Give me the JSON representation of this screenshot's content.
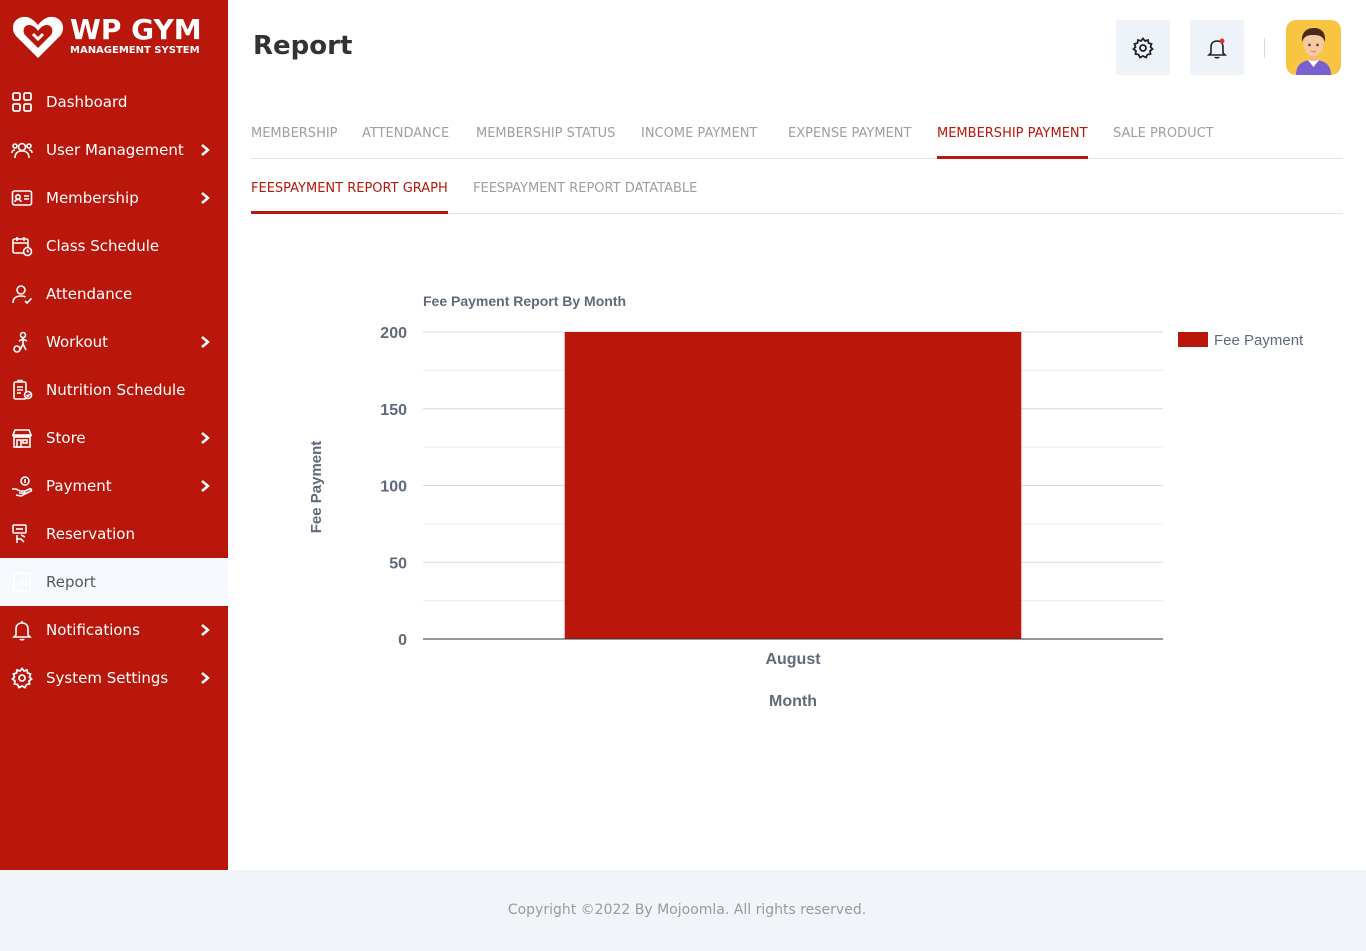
{
  "brand": {
    "title": "WP GYM",
    "subtitle": "MANAGEMENT SYSTEM"
  },
  "sidebar": {
    "items": [
      {
        "label": "Dashboard",
        "icon": "dashboard-icon",
        "has_submenu": false,
        "active": false
      },
      {
        "label": "User Management",
        "icon": "users-icon",
        "has_submenu": true,
        "active": false
      },
      {
        "label": "Membership",
        "icon": "membership-card-icon",
        "has_submenu": true,
        "active": false
      },
      {
        "label": "Class Schedule",
        "icon": "calendar-clock-icon",
        "has_submenu": false,
        "active": false
      },
      {
        "label": "Attendance",
        "icon": "user-check-icon",
        "has_submenu": false,
        "active": false
      },
      {
        "label": "Workout",
        "icon": "workout-icon",
        "has_submenu": true,
        "active": false
      },
      {
        "label": "Nutrition Schedule",
        "icon": "nutrition-list-icon",
        "has_submenu": false,
        "active": false
      },
      {
        "label": "Store",
        "icon": "store-icon",
        "has_submenu": true,
        "active": false
      },
      {
        "label": "Payment",
        "icon": "payment-hand-icon",
        "has_submenu": true,
        "active": false
      },
      {
        "label": "Reservation",
        "icon": "reservation-icon",
        "has_submenu": false,
        "active": false
      },
      {
        "label": "Report",
        "icon": "report-icon",
        "has_submenu": false,
        "active": true
      },
      {
        "label": "Notifications",
        "icon": "bell-icon",
        "has_submenu": true,
        "active": false
      },
      {
        "label": "System Settings",
        "icon": "gear-icon",
        "has_submenu": true,
        "active": false
      }
    ]
  },
  "header": {
    "title": "Report",
    "settings_icon": "gear-icon",
    "notification_icon": "bell-icon",
    "avatar_icon": "user-avatar-icon"
  },
  "tabs": [
    {
      "label": "MEMBERSHIP",
      "active": false
    },
    {
      "label": "ATTENDANCE",
      "active": false
    },
    {
      "label": "MEMBERSHIP STATUS",
      "active": false
    },
    {
      "label": "INCOME PAYMENT",
      "active": false
    },
    {
      "label": "EXPENSE PAYMENT",
      "active": false
    },
    {
      "label": "MEMBERSHIP PAYMENT",
      "active": true
    },
    {
      "label": "SALE PRODUCT",
      "active": false
    }
  ],
  "subtabs": [
    {
      "label": "FEESPAYMENT REPORT GRAPH",
      "active": true
    },
    {
      "label": "FEESPAYMENT REPORT DATATABLE",
      "active": false
    }
  ],
  "chart_data": {
    "type": "bar",
    "title": "Fee Payment Report By Month",
    "xlabel": "Month",
    "ylabel": "Fee Payment",
    "categories": [
      "August"
    ],
    "series": [
      {
        "name": "Fee Payment",
        "values": [
          200
        ],
        "color": "#b9170c"
      }
    ],
    "ylim": [
      0,
      200
    ],
    "yticks": [
      0,
      50,
      100,
      150,
      200
    ],
    "grid": true,
    "legend": "right"
  },
  "footer": {
    "text": "Copyright ©2022 By Mojoomla. All rights reserved."
  },
  "colors": {
    "brand": "#b9170c",
    "active_bg": "#f5f8fd",
    "footer_bg": "#f1f4f9"
  }
}
